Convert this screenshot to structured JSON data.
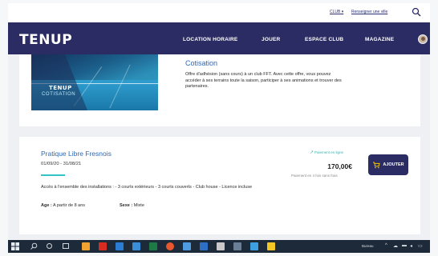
{
  "header": {
    "club_link": "CLUB ▾",
    "search_link": "Renseigner une ville",
    "logo": "TENUP",
    "nav": [
      "LOCATION HORAIRE",
      "JOUER",
      "ESPACE CLUB",
      "MAGAZINE"
    ]
  },
  "cotisation": {
    "image_title": "TENUP",
    "image_subtitle": "COTISATION",
    "title": "Cotisation",
    "description": "Offre d'adhésion (sans cours) à un club FFT. Avec cette offre, vous pouvez accéder à ses terrains toute la saison, participer à ses animations et trouver des partenaires."
  },
  "offer": {
    "title": "Pratique Libre Fresnois",
    "dates": "01/09/20 - 31/08/21",
    "description": "Accès à l'ensemble des installations : - 3 courts extérieurs - 3 courts couverts - Club house - Licence incluse",
    "age_label": "Age :",
    "age_value": "A partir de 8 ans",
    "sex_label": "Sexe :",
    "sex_value": "Mixte",
    "payment_online": "Paiement en ligne",
    "price": "170,00€",
    "installments": "Paiement en 4 fois sans frais",
    "add_button": "AJOUTER"
  },
  "taskbar": {
    "language": "Bureau"
  },
  "colors": {
    "nav_bg": "#2b2c63",
    "title_blue": "#2f67b2",
    "accent_teal": "#33c4c6",
    "taskbar_bg": "#1d2a3a"
  }
}
